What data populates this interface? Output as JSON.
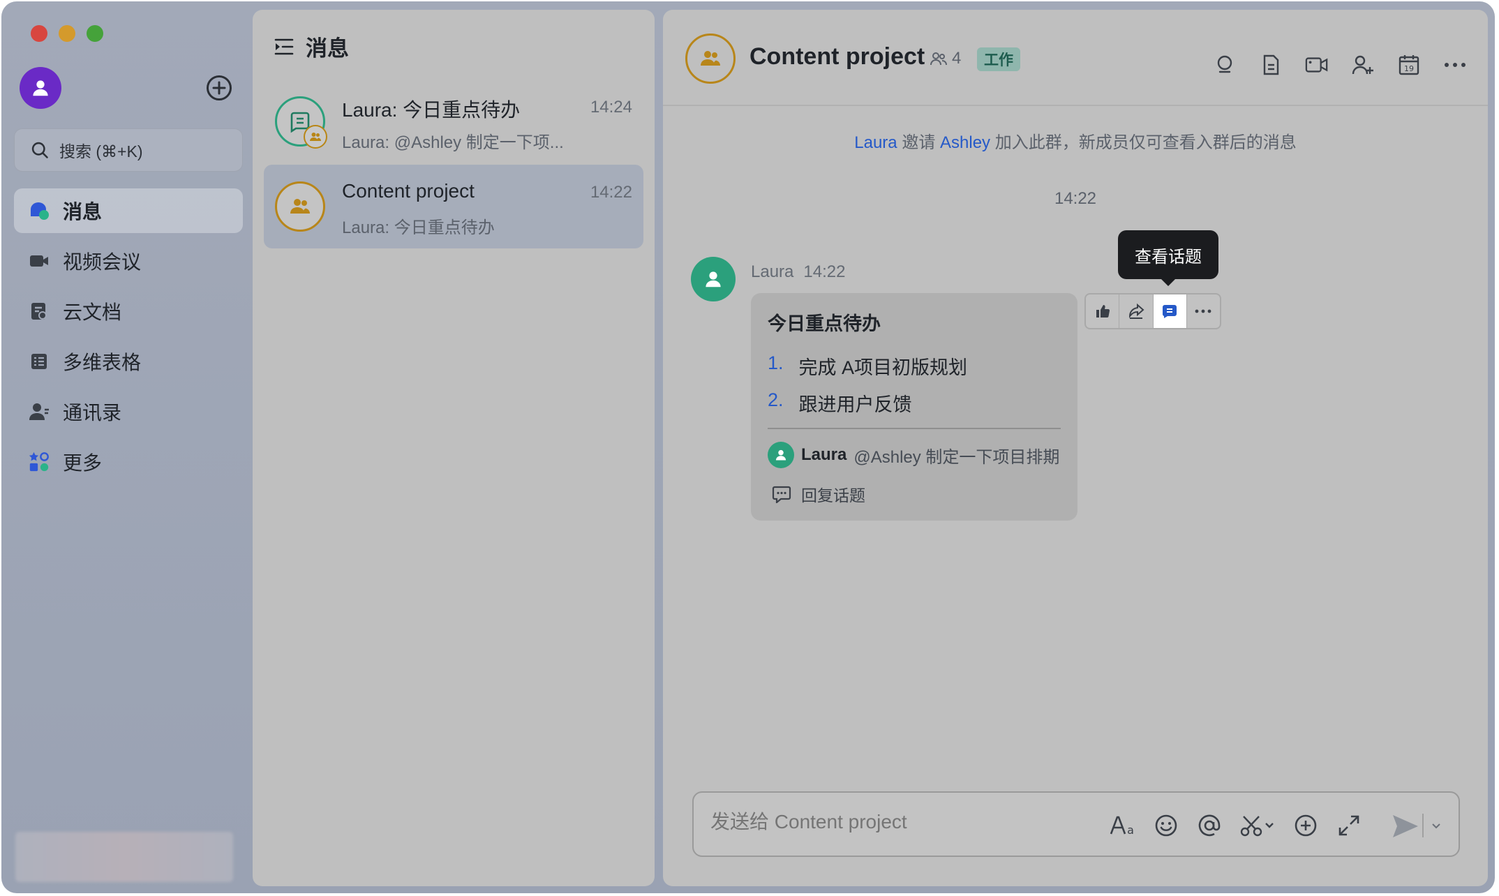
{
  "sidebar": {
    "search_placeholder": "搜索 (⌘+K)",
    "nav": [
      {
        "label": "消息",
        "icon": "chat-bubble-icon",
        "active": true
      },
      {
        "label": "视频会议",
        "icon": "video-camera-icon"
      },
      {
        "label": "云文档",
        "icon": "cloud-doc-icon"
      },
      {
        "label": "多维表格",
        "icon": "table-grid-icon"
      },
      {
        "label": "通讯录",
        "icon": "contacts-icon"
      },
      {
        "label": "更多",
        "icon": "apps-more-icon"
      }
    ]
  },
  "chatlist": {
    "title": "消息",
    "items": [
      {
        "title": "Laura: 今日重点待办",
        "time": "14:24",
        "preview": "Laura: @Ashley 制定一下项..."
      },
      {
        "title": "Content project",
        "time": "14:22",
        "preview": "Laura: 今日重点待办",
        "active": true
      }
    ]
  },
  "chat": {
    "title": "Content project",
    "member_count": "4",
    "tag": "工作",
    "system_message": {
      "inviter": "Laura",
      "verb": "邀请",
      "invitee": "Ashley",
      "rest": "加入此群，新成员仅可查看入群后的消息"
    },
    "time_divider": "14:22",
    "message": {
      "sender": "Laura",
      "time": "14:22",
      "title": "今日重点待办",
      "items": [
        {
          "num": "1.",
          "text": "完成 A项目初版规划"
        },
        {
          "num": "2.",
          "text": "跟进用户反馈"
        }
      ],
      "thread_sender": "Laura",
      "thread_text": "@Ashley 制定一下项目排期",
      "reply_label": "回复话题"
    },
    "tooltip": "查看话题",
    "composer_placeholder": "发送给 Content project"
  },
  "colors": {
    "accent": "#2559c8",
    "green_avatar": "#2ba07c",
    "group_gold": "#b8861a",
    "tag_bg": "#8fb6ad"
  }
}
